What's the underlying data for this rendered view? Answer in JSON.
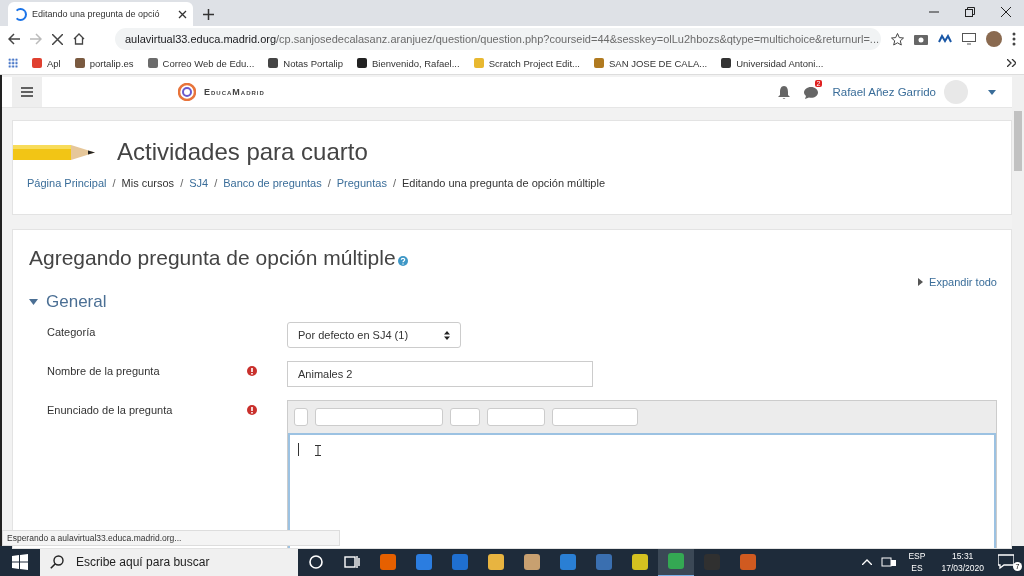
{
  "browser": {
    "tab": {
      "title": "Editando una pregunta de opció",
      "loading": true
    },
    "address": {
      "host": "aulavirtual33.educa.madrid.org",
      "path": "/cp.sanjosedecalasanz.aranjuez/question/question.php?courseid=44&sesskey=olLu2hbozs&qtype=multichoice&returnurl=..."
    },
    "bookmarks": [
      {
        "label": "Apl",
        "color": "#e04030"
      },
      {
        "label": "portalip.es",
        "color": "#7a5a40"
      },
      {
        "label": "Correo Web de Edu...",
        "color": "#6b6b6b"
      },
      {
        "label": "Notas Portalip",
        "color": "#444444"
      },
      {
        "label": "Bienvenido, Rafael...",
        "color": "#222222"
      },
      {
        "label": "Scratch Project Edit...",
        "color": "#e8b830"
      },
      {
        "label": "SAN JOSE DE CALA...",
        "color": "#b07a20"
      },
      {
        "label": "Universidad Antoni...",
        "color": "#333333"
      }
    ]
  },
  "navbar": {
    "brand": "EducaMadrid",
    "message_count": "2",
    "user": "Rafael Añez Garrido"
  },
  "header": {
    "title": "Actividades para cuarto",
    "breadcrumbs": [
      {
        "label": "Página Principal",
        "link": true
      },
      {
        "separator": "/",
        "label": "Mis cursos",
        "link": false
      },
      {
        "separator": "/",
        "label": "SJ4",
        "link": true
      },
      {
        "separator": "/",
        "label": "Banco de preguntas",
        "link": true
      },
      {
        "separator": "/",
        "label": "Preguntas",
        "link": true
      },
      {
        "separator": "/",
        "label": "Editando una pregunta de opción múltiple",
        "link": false
      }
    ]
  },
  "form": {
    "heading": "Agregando pregunta de opción múltiple",
    "expand_all": "Expandir todo",
    "section": {
      "title": "General",
      "expanded": true
    },
    "fields": [
      {
        "label": "Categoría",
        "kind": "select",
        "required": false,
        "value": "Por defecto en SJ4 (1)"
      },
      {
        "label": "Nombre de la pregunta",
        "kind": "text",
        "required": true,
        "value": "Animales 2"
      },
      {
        "label": "Enunciado de la pregunta",
        "kind": "editor",
        "required": true
      }
    ]
  },
  "status_text": "Esperando a aulavirtual33.educa.madrid.org...",
  "taskbar": {
    "search_placeholder": "Escribe aquí para buscar",
    "apps": [
      {
        "color": "#e66000",
        "selected": false
      },
      {
        "color": "#2b7de0",
        "selected": false
      },
      {
        "color": "#1f6fd0",
        "selected": false
      },
      {
        "color": "#e8b440",
        "selected": false
      },
      {
        "color": "#c8a070",
        "selected": false
      },
      {
        "color": "#2a7fd4",
        "selected": false
      },
      {
        "color": "#3a6fb0",
        "selected": false
      },
      {
        "color": "#d4c020",
        "selected": false
      },
      {
        "color": "#34a853",
        "selected": true
      },
      {
        "color": "#303030",
        "selected": false
      },
      {
        "color": "#d05a20",
        "selected": false
      }
    ],
    "input_lang": "ESP",
    "keyboard": "ES",
    "time": "15:31",
    "date": "17/03/2020",
    "notifications": "7"
  }
}
